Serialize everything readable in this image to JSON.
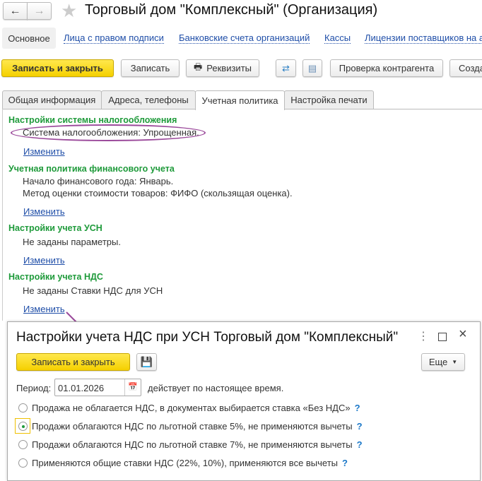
{
  "window": {
    "title": "Торговый дом \"Комплексный\" (Организация)"
  },
  "nav": {
    "items": [
      {
        "label": "Основное"
      },
      {
        "label": "Лица с правом подписи"
      },
      {
        "label": "Банковские счета организаций"
      },
      {
        "label": "Кассы"
      },
      {
        "label": "Лицензии поставщиков на а"
      }
    ]
  },
  "toolbar": {
    "save_close": "Записать и закрыть",
    "save": "Записать",
    "requisites": "Реквизиты",
    "check": "Проверка контрагента",
    "create": "Созда"
  },
  "tabs": [
    {
      "label": "Общая информация"
    },
    {
      "label": "Адреса, телефоны"
    },
    {
      "label": "Учетная политика"
    },
    {
      "label": "Настройка печати"
    }
  ],
  "sections": [
    {
      "header": "Настройки системы налогообложения",
      "lines": [
        "Система налогообложения: Упрощенная."
      ],
      "link": "Изменить"
    },
    {
      "header": "Учетная политика финансового учета",
      "lines": [
        "Начало финансового года: Январь.",
        "Метод оценки стоимости товаров: ФИФО (скользящая оценка)."
      ],
      "link": "Изменить"
    },
    {
      "header": "Настройки учета УСН",
      "lines": [
        "Не заданы параметры."
      ],
      "link": "Изменить"
    },
    {
      "header": "Настройки учета НДС",
      "lines": [
        "Не заданы Ставки НДС для УСН"
      ],
      "link": "Изменить"
    }
  ],
  "dialog": {
    "title": "Настройки учета НДС при УСН Торговый дом \"Комплексный\"",
    "save_close": "Записать и закрыть",
    "more": "Еще",
    "period_label": "Период:",
    "period_value": "01.01.2026",
    "period_note": "действует по настоящее время.",
    "options": [
      {
        "label": "Продажа не облагается НДС, в документах выбирается ставка «Без НДС»",
        "selected": false
      },
      {
        "label": "Продажи облагаются НДС по льготной ставке 5%, не применяются вычеты",
        "selected": true
      },
      {
        "label": "Продажи облагаются НДС по льготной ставке 7%, не применяются вычеты",
        "selected": false
      },
      {
        "label": "Применяются общие ставки НДС (22%, 10%), применяются все вычеты",
        "selected": false
      }
    ],
    "help": "?"
  },
  "colors": {
    "accent": "#f5d000",
    "section": "#1e9a3a",
    "link": "#1f4ea8",
    "highlight": "#9b4a9b"
  }
}
